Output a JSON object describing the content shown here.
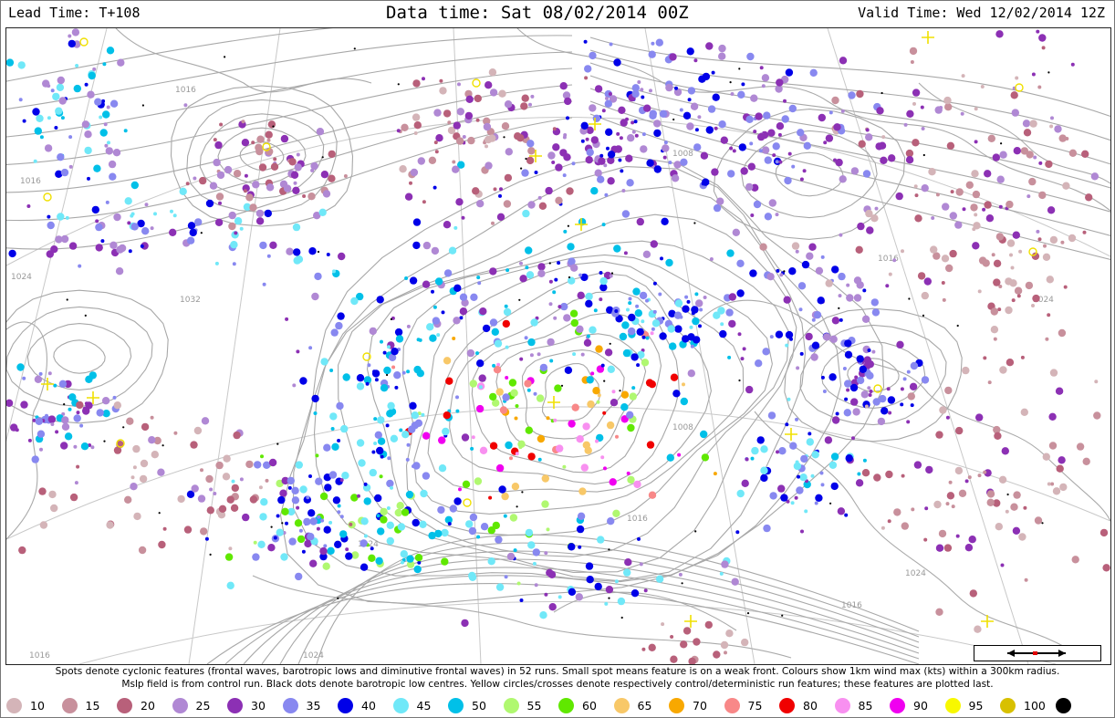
{
  "header": {
    "lead_time": "Lead Time: T+108",
    "data_time": "Data time:  Sat 08/02/2014 00Z",
    "valid_time": "Valid Time: Wed 12/02/2014 12Z"
  },
  "footer": {
    "line1": "Spots denote cyclonic features (frontal waves, barotropic lows and diminutive frontal waves) in 52 runs. Small spot means feature is on a weak front. Colours show 1km wind max (kts) within a 300km radius.",
    "line2": "Mslp field is from control run. Black dots denote barotropic low centres. Yellow circles/crosses denote respectively control/deterministic run features; these features are plotted last."
  },
  "legend": [
    {
      "label": "10",
      "color": "#d4b4b8"
    },
    {
      "label": "15",
      "color": "#c8909c"
    },
    {
      "label": "20",
      "color": "#b8607a"
    },
    {
      "label": "25",
      "color": "#b088d4"
    },
    {
      "label": "30",
      "color": "#8c30b4"
    },
    {
      "label": "35",
      "color": "#8888f0"
    },
    {
      "label": "40",
      "color": "#0000e8"
    },
    {
      "label": "45",
      "color": "#70e8f8"
    },
    {
      "label": "50",
      "color": "#00c0e8"
    },
    {
      "label": "55",
      "color": "#b0f870"
    },
    {
      "label": "60",
      "color": "#60e800"
    },
    {
      "label": "65",
      "color": "#f8c868"
    },
    {
      "label": "70",
      "color": "#f8a800"
    },
    {
      "label": "75",
      "color": "#f88888"
    },
    {
      "label": "80",
      "color": "#f00000"
    },
    {
      "label": "85",
      "color": "#f890f0"
    },
    {
      "label": "90",
      "color": "#f000f0"
    },
    {
      "label": "95",
      "color": "#f8f800"
    },
    {
      "label": "100",
      "color": "#d8c000"
    },
    {
      "label": "",
      "color": "#000000"
    }
  ],
  "isobar_labels": [
    "1016",
    "1016",
    "1024",
    "1032",
    "1008",
    "1016",
    "1024",
    "1024",
    "1016",
    "1024",
    "1008",
    "1016",
    "1024",
    "1016"
  ],
  "icons": {
    "scale": "scale-bar-icon",
    "coast": "coastline-icon"
  }
}
